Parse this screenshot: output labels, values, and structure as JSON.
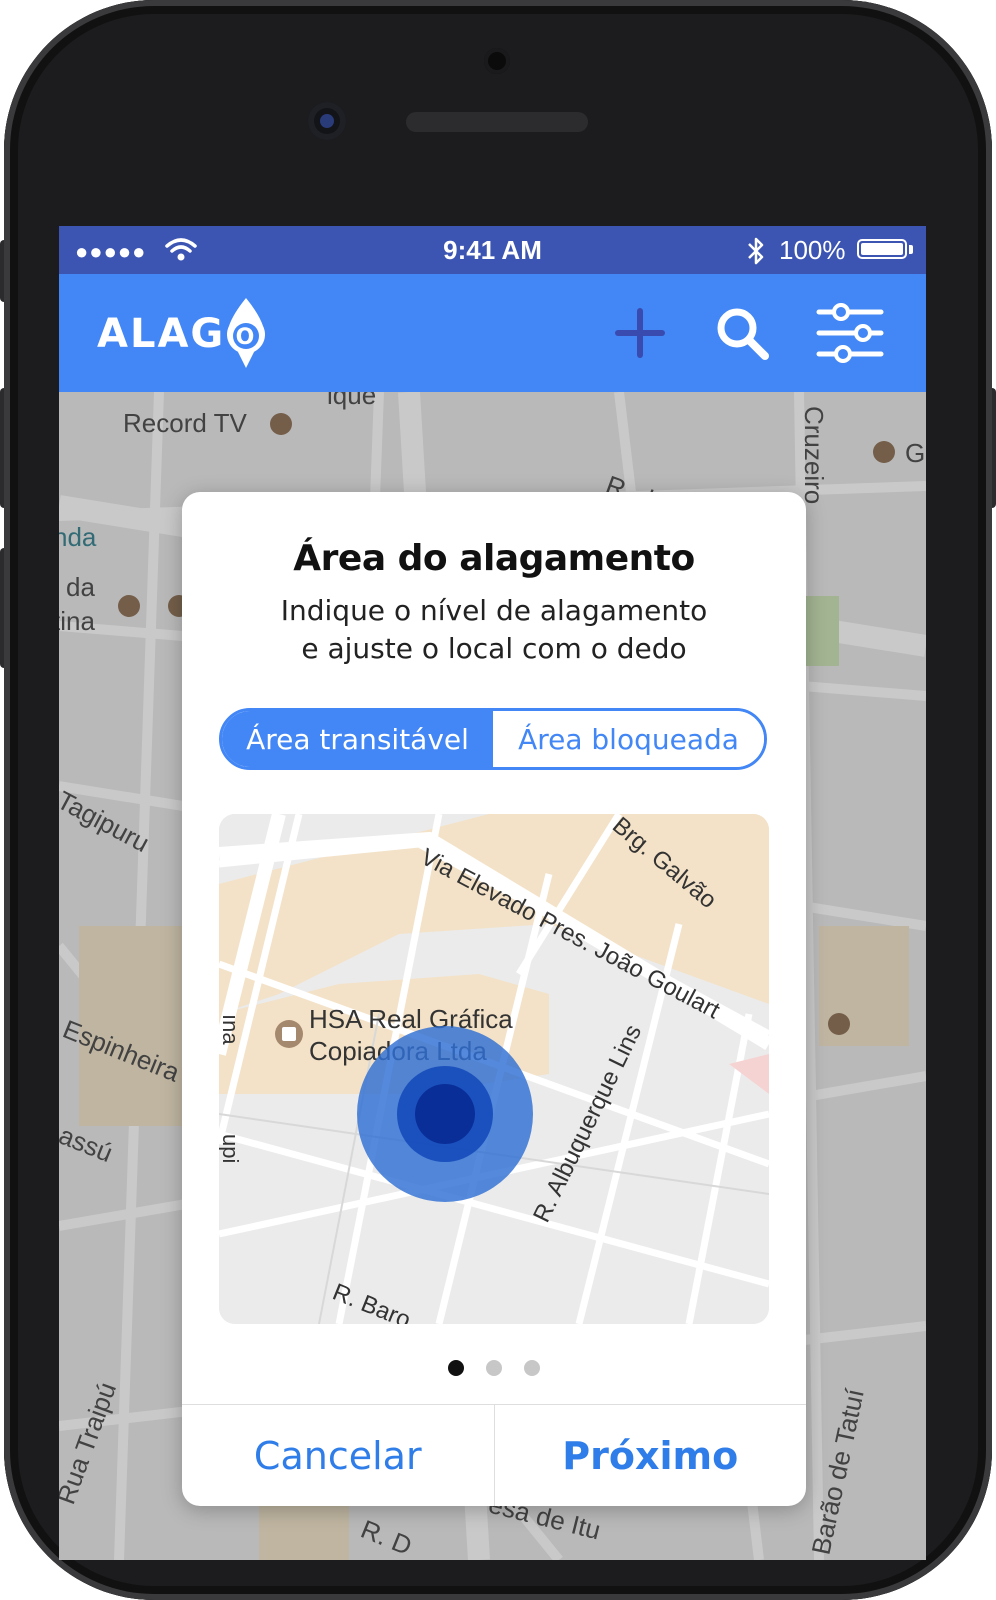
{
  "status_bar": {
    "signal": "●●●●●",
    "time": "9:41 AM",
    "battery": "100%",
    "icons": [
      "wifi-icon",
      "bluetooth-icon",
      "battery-icon"
    ]
  },
  "app_bar": {
    "logo_text_left": "ALAG",
    "logo_text_right": "O",
    "actions": [
      "add-icon",
      "search-icon",
      "filter-sliders-icon"
    ]
  },
  "background_map": {
    "labels": [
      "Record TV",
      "ique",
      "R. d",
      "Cruzeiro",
      "G",
      "nda",
      "l da",
      "tina",
      "Tagipuru",
      "Espinheira",
      "assú",
      "Rua Traipú",
      "esa de Itu",
      "R. D",
      "Barão de Tatuí"
    ]
  },
  "dialog": {
    "title": "Área do alagamento",
    "subtitle_line1": "Indique o nível de alagamento",
    "subtitle_line2": "e ajuste o local com o dedo",
    "segments": {
      "left": "Área transitável",
      "right": "Área bloqueada",
      "selected": "left"
    },
    "map_labels": {
      "street1": "Via Elevado Pres. João Goulart",
      "street2": "Brg. Galvão",
      "street3": "R. Albuquerque Lins",
      "street4": "R. Baro",
      "street5": "ına",
      "street6": "upi",
      "poi_line1": "HSA Real Gráfica",
      "poi_line2": "Copiadora Ltda"
    },
    "page_indicator": {
      "count": 3,
      "active": 1
    },
    "cancel_label": "Cancelar",
    "next_label": "Próximo"
  },
  "colors": {
    "status_bar": "#3d55b2",
    "app_bar": "#4287f5",
    "accent": "#2f7de8",
    "flood_outer": "#3a78d6",
    "flood_inner": "#0b3aa8"
  }
}
